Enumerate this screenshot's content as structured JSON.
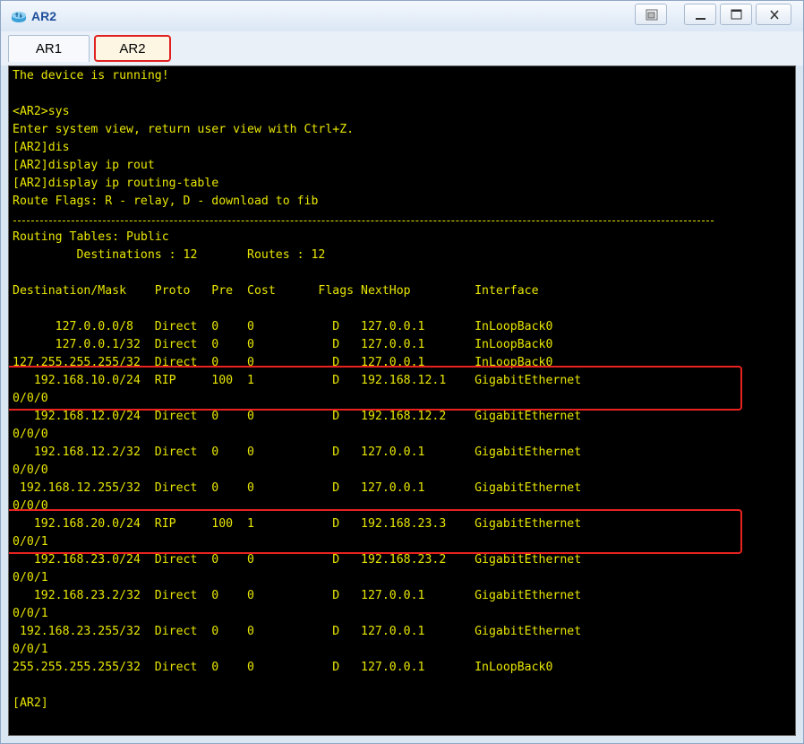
{
  "window": {
    "title": "AR2",
    "accent": "#1f4f9a"
  },
  "tabs": [
    {
      "label": "AR1",
      "active": false
    },
    {
      "label": "AR2",
      "active": true
    }
  ],
  "terminal": {
    "text_color": "#e8e600",
    "background": "#000000",
    "highlight_color": "#e8231f",
    "lines": [
      "The device is running!",
      "",
      "<AR2>sys",
      "Enter system view, return user view with Ctrl+Z.",
      "[AR2]dis",
      "[AR2]display ip rout",
      "[AR2]display ip routing-table",
      "Route Flags: R - relay, D - download to fib",
      "",
      "Routing Tables: Public",
      "         Destinations : 12       Routes : 12",
      "",
      "Destination/Mask    Proto   Pre  Cost      Flags NextHop         Interface",
      "",
      "      127.0.0.0/8   Direct  0    0           D   127.0.0.1       InLoopBack0",
      "      127.0.0.1/32  Direct  0    0           D   127.0.0.1       InLoopBack0",
      "127.255.255.255/32  Direct  0    0           D   127.0.0.1       InLoopBack0",
      "   192.168.10.0/24  RIP     100  1           D   192.168.12.1    GigabitEthernet",
      "0/0/0",
      "   192.168.12.0/24  Direct  0    0           D   192.168.12.2    GigabitEthernet",
      "0/0/0",
      "   192.168.12.2/32  Direct  0    0           D   127.0.0.1       GigabitEthernet",
      "0/0/0",
      " 192.168.12.255/32  Direct  0    0           D   127.0.0.1       GigabitEthernet",
      "0/0/0",
      "   192.168.20.0/24  RIP     100  1           D   192.168.23.3    GigabitEthernet",
      "0/0/1",
      "   192.168.23.0/24  Direct  0    0           D   192.168.23.2    GigabitEthernet",
      "0/0/1",
      "   192.168.23.2/32  Direct  0    0           D   127.0.0.1       GigabitEthernet",
      "0/0/1",
      " 192.168.23.255/32  Direct  0    0           D   127.0.0.1       GigabitEthernet",
      "0/0/1",
      "255.255.255.255/32  Direct  0    0           D   127.0.0.1       InLoopBack0",
      "",
      "[AR2]"
    ]
  }
}
